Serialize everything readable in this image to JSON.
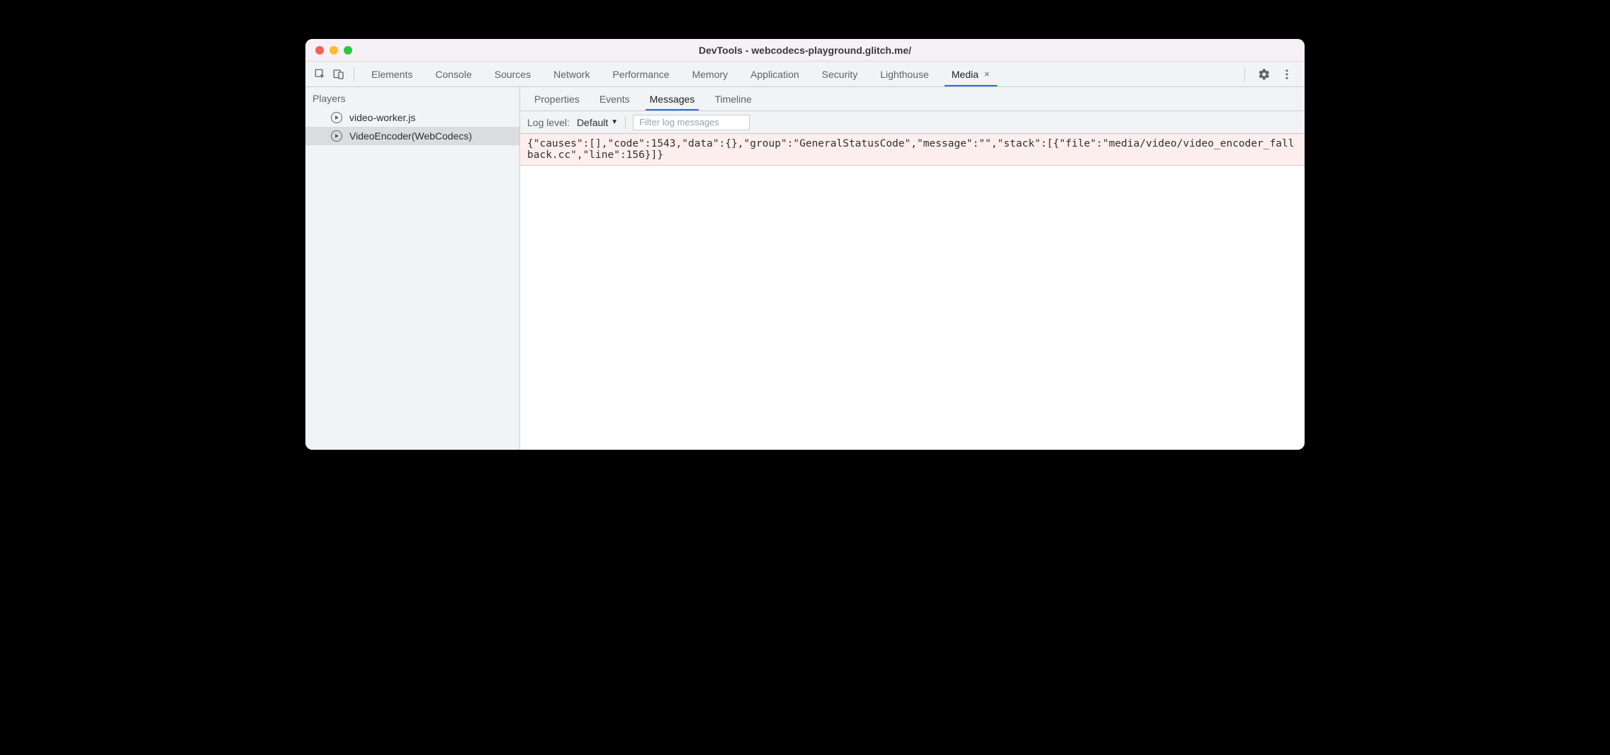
{
  "window": {
    "title": "DevTools - webcodecs-playground.glitch.me/"
  },
  "mainTabs": {
    "items": [
      {
        "label": "Elements"
      },
      {
        "label": "Console"
      },
      {
        "label": "Sources"
      },
      {
        "label": "Network"
      },
      {
        "label": "Performance"
      },
      {
        "label": "Memory"
      },
      {
        "label": "Application"
      },
      {
        "label": "Security"
      },
      {
        "label": "Lighthouse"
      },
      {
        "label": "Media"
      }
    ],
    "activeIndex": 9
  },
  "sidebar": {
    "header": "Players",
    "items": [
      {
        "label": "video-worker.js"
      },
      {
        "label": "VideoEncoder(WebCodecs)"
      }
    ],
    "selectedIndex": 1
  },
  "subTabs": {
    "items": [
      {
        "label": "Properties"
      },
      {
        "label": "Events"
      },
      {
        "label": "Messages"
      },
      {
        "label": "Timeline"
      }
    ],
    "activeIndex": 2
  },
  "filter": {
    "logLevelLabel": "Log level:",
    "logLevelValue": "Default",
    "placeholder": "Filter log messages",
    "value": ""
  },
  "messages": [
    {
      "text": "{\"causes\":[],\"code\":1543,\"data\":{},\"group\":\"GeneralStatusCode\",\"message\":\"\",\"stack\":[{\"file\":\"media/video/video_encoder_fallback.cc\",\"line\":156}]}"
    }
  ]
}
